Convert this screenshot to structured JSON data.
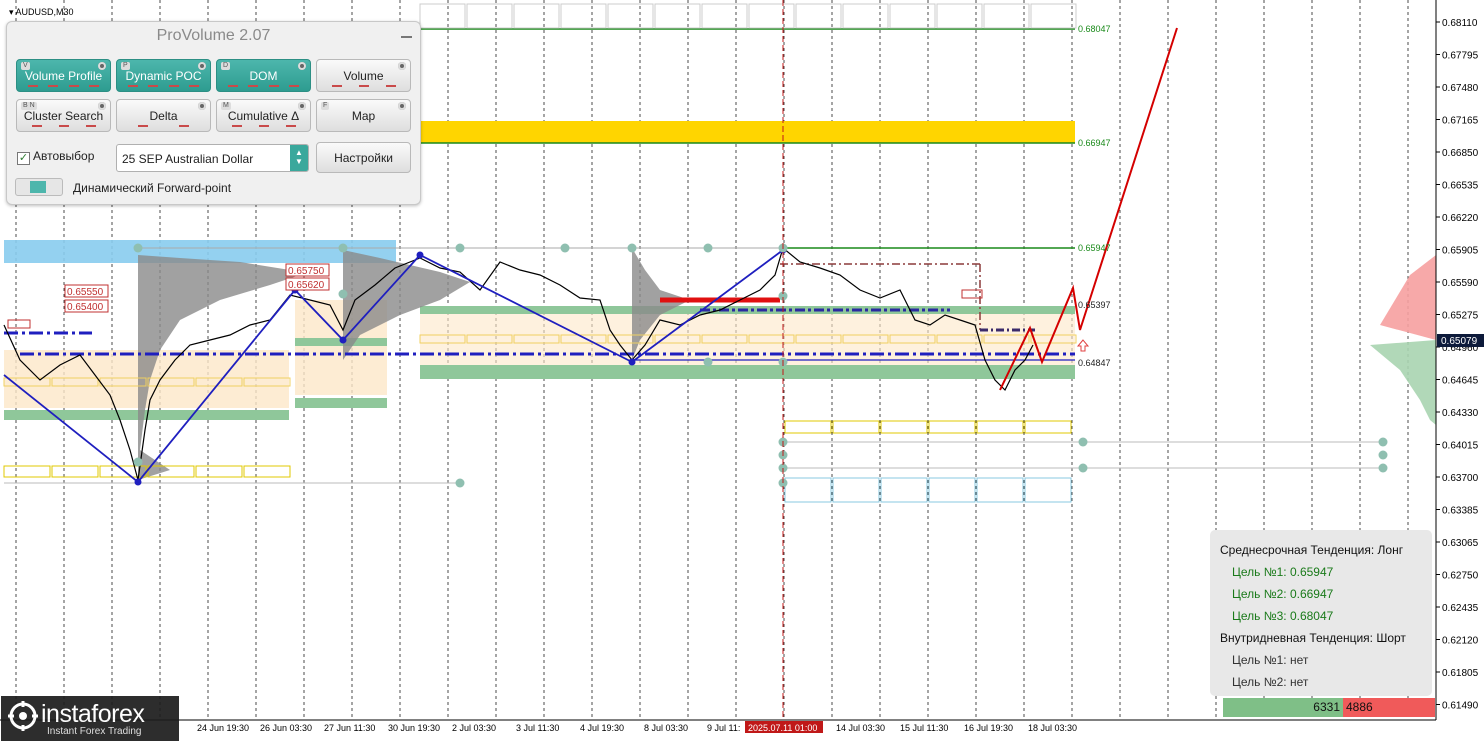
{
  "chart_title": "AUDUSD,M30",
  "colors": {
    "bg": "#ffffff",
    "grid": "#000000",
    "price": "#000000",
    "zigzag": "#1f1fbf",
    "forecast": "#d40000",
    "target_line": "#1a8a1a",
    "yellow_zone": "#ffd500",
    "green_zone": "#8fc79a",
    "blue_zone": "#88ccee",
    "teal_button": "#3aa89c",
    "current_price_bg": "#0d1a3a"
  },
  "price_axis": {
    "labels": [
      "0.68110",
      "0.67795",
      "0.67480",
      "0.67165",
      "0.66850",
      "0.66535",
      "0.66220",
      "0.65905",
      "0.65590",
      "0.65275",
      "0.64960",
      "0.64645",
      "0.64330",
      "0.64015",
      "0.63700",
      "0.63385",
      "0.63065",
      "0.62750",
      "0.62435",
      "0.62120",
      "0.61805",
      "0.61490"
    ],
    "current_price": "0.65079",
    "range": [
      0.6149,
      0.6811
    ]
  },
  "time_axis": {
    "labels": [
      "24 Jun 19:30",
      "26 Jun 03:30",
      "27 Jun 11:30",
      "30 Jun 19:30",
      "2 Jul 03:30",
      "3 Jul 11:30",
      "4 Jul 19:30",
      "8 Jul 03:30",
      "9 Jul 11:",
      "14 Jul 03:30",
      "15 Jul 11:30",
      "16 Jul 19:30",
      "18 Jul 03:30"
    ],
    "highlight_label": "2025.07.11 01:00"
  },
  "levels": {
    "target3": "0.68047",
    "target2": "0.66947",
    "target1": "0.65947",
    "upper": "0.65397",
    "lower": "0.64847"
  },
  "box_labels": [
    "0.65550",
    "0.65400",
    "0.65750",
    "0.65620"
  ],
  "panel": {
    "title": "ProVolume 2.07",
    "buttons": [
      {
        "key": "V",
        "label": "Volume Profile",
        "active": true
      },
      {
        "key": "P",
        "label": "Dynamic POC",
        "active": true
      },
      {
        "key": "D",
        "label": "DOM",
        "active": true
      },
      {
        "key": "",
        "label": "Volume",
        "active": false
      },
      {
        "key": "B  N",
        "label": "Cluster Search",
        "active": false
      },
      {
        "key": "",
        "label": "Delta",
        "active": false
      },
      {
        "key": "M",
        "label": "Cumulative Δ",
        "active": false
      },
      {
        "key": "F",
        "label": "Map",
        "active": false
      }
    ],
    "auto_select_label": "Автовыбор",
    "instrument": "25 SEP Australian Dollar",
    "settings_label": "Настройки",
    "forward_point_label": "Динамический Forward-point"
  },
  "info_box": {
    "line1": "Среднесрочная Тенденция: Лонг",
    "t1": "Цель №1: 0.65947",
    "t2": "Цель №2: 0.66947",
    "t3": "Цель №3: 0.68047",
    "line2": "Внутридневная Тенденция: Шорт",
    "i1": "Цель №1: нет",
    "i2": "Цель №2: нет"
  },
  "volume_bar": {
    "buy": "6331",
    "sell": "4886"
  },
  "logo": {
    "name": "instaforex",
    "tagline": "Instant Forex Trading"
  }
}
